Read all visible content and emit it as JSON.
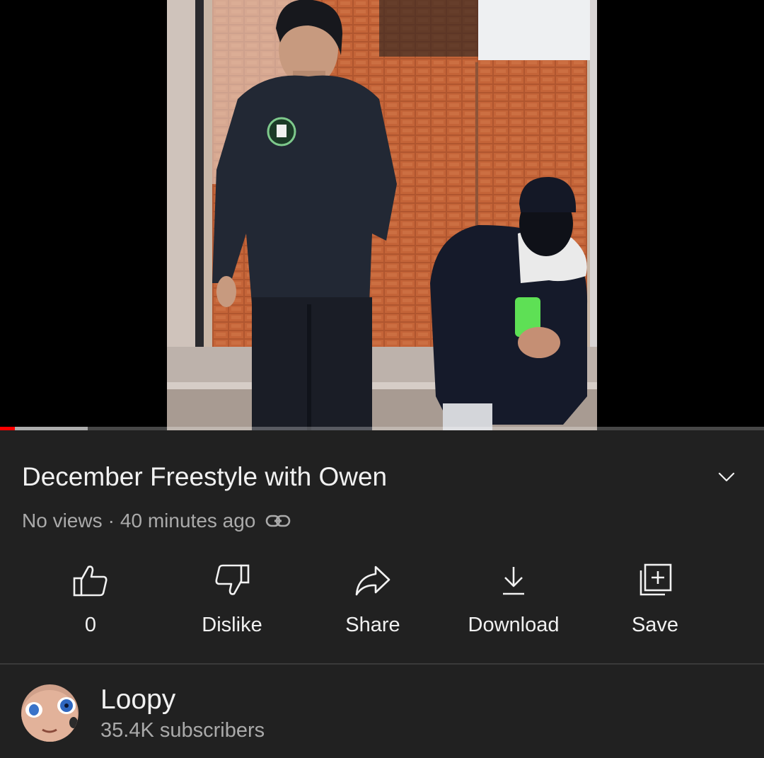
{
  "video": {
    "title": "December Freestyle with Owen",
    "views": "No views",
    "separator": "·",
    "uploaded": "40 minutes ago",
    "progress_fraction": 0.019,
    "buffered_fraction": 0.115
  },
  "actions": [
    {
      "label": "0",
      "icon": "thumbs-up-icon"
    },
    {
      "label": "Dislike",
      "icon": "thumbs-down-icon"
    },
    {
      "label": "Share",
      "icon": "share-arrow-icon"
    },
    {
      "label": "Download",
      "icon": "download-icon"
    },
    {
      "label": "Save",
      "icon": "save-playlist-icon"
    }
  ],
  "channel": {
    "name": "Loopy",
    "subscribers": "35.4K subscribers"
  },
  "colors": {
    "background": "#212121",
    "text_primary": "#f1f1f1",
    "text_secondary": "#aaaaaa",
    "progress_played": "#ff0000"
  }
}
